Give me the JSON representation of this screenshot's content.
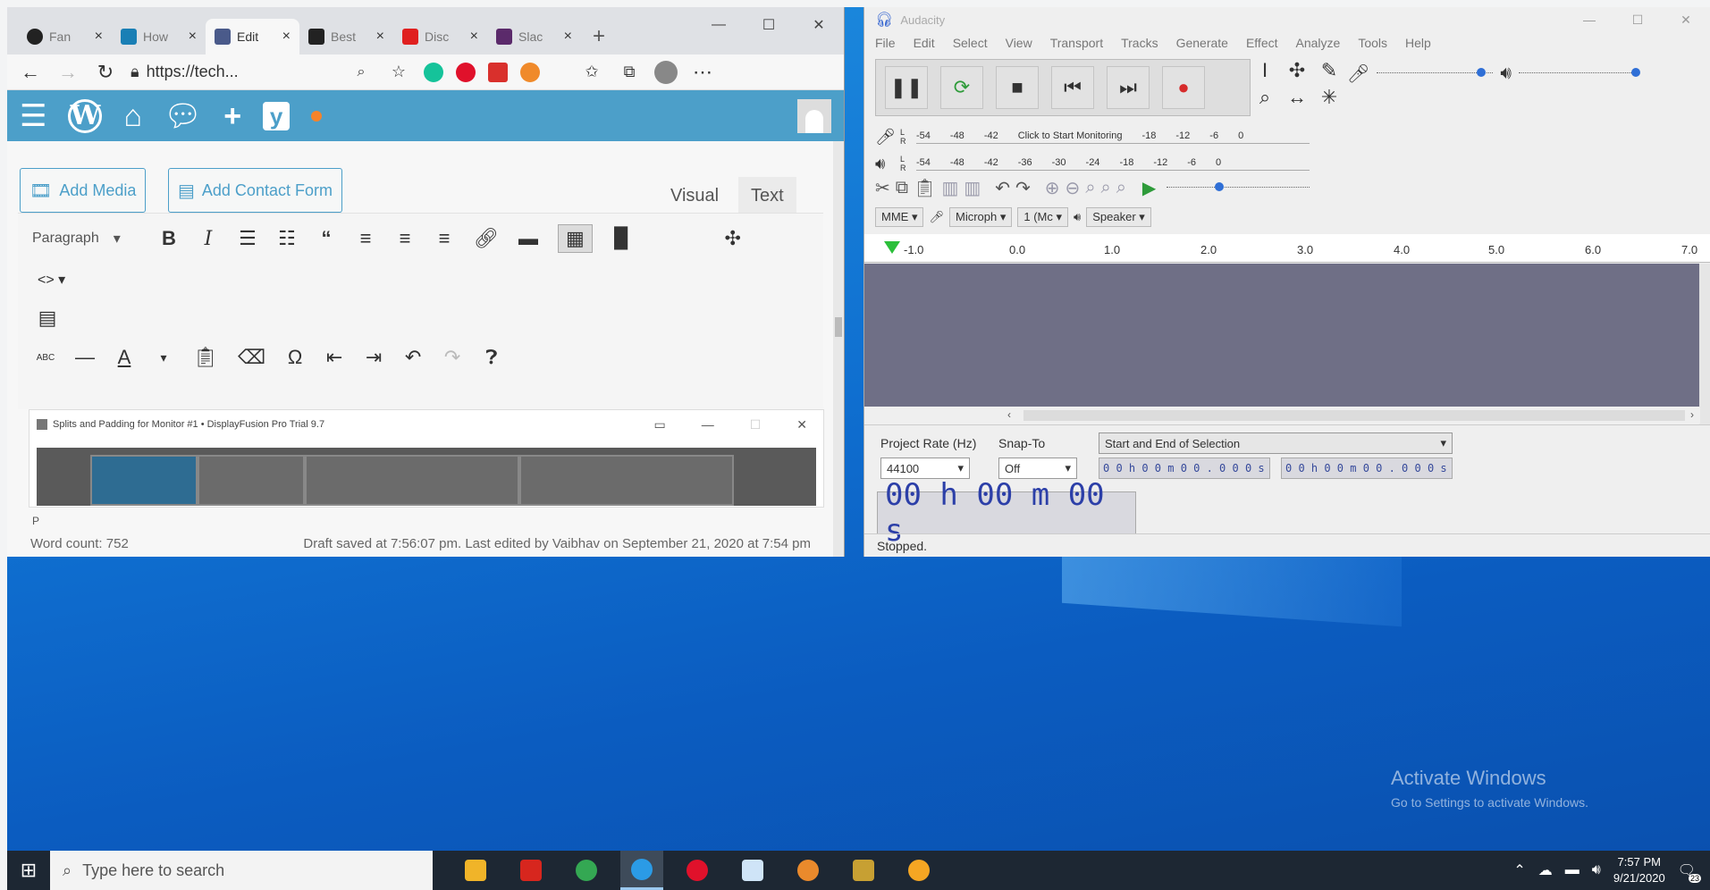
{
  "browser": {
    "tabs": [
      {
        "label": "Fan",
        "color": "#222222"
      },
      {
        "label": "How",
        "color": "#1a7fb5"
      },
      {
        "label": "Edit",
        "color": "#4a5a8a"
      },
      {
        "label": "Best",
        "color": "#222222"
      },
      {
        "label": "Disc",
        "color": "#e02020"
      },
      {
        "label": "Slac",
        "color": "#5b2a6b"
      }
    ],
    "new_tab": "+",
    "url": "https://tech...",
    "window_controls": {
      "minimize": "—",
      "maximize": "☐",
      "close": "✕"
    }
  },
  "wordpress": {
    "add_media": "Add Media",
    "add_contact_form": "Add Contact Form",
    "visual_tab": "Visual",
    "text_tab": "Text",
    "format_select": "Paragraph",
    "paragraph_marker": "P",
    "word_count": "Word count: 752",
    "draft_status": "Draft saved at 7:56:07 pm. Last edited by Vaibhav on September 21, 2020 at 7:54 pm"
  },
  "displayfusion": {
    "title": "Splits and Padding for Monitor #1 • DisplayFusion Pro Trial 9.7"
  },
  "audacity": {
    "title": "Audacity",
    "menu": [
      "File",
      "Edit",
      "Select",
      "View",
      "Transport",
      "Tracks",
      "Generate",
      "Effect",
      "Analyze",
      "Tools",
      "Help"
    ],
    "record_meter_ticks": [
      "-54",
      "-48",
      "-42",
      "Click to Start Monitoring",
      "-18",
      "-12",
      "-6",
      "0"
    ],
    "play_meter_ticks": [
      "-54",
      "-48",
      "-42",
      "-36",
      "-30",
      "-24",
      "-18",
      "-12",
      "-6",
      "0"
    ],
    "host": "MME",
    "input_device": "Microph",
    "channels": "1 (Mc",
    "output_device": "Speaker",
    "ruler_ticks": [
      "-1.0",
      "0.0",
      "1.0",
      "2.0",
      "3.0",
      "4.0",
      "5.0",
      "6.0",
      "7.0"
    ],
    "project_rate_label": "Project Rate (Hz)",
    "project_rate_value": "44100",
    "snap_to_label": "Snap-To",
    "snap_to_value": "Off",
    "selection_mode": "Start and End of Selection",
    "selection_start": "0 0 h 0 0 m 0 0 . 0 0 0 s",
    "selection_end": "0 0 h 0 0 m 0 0 . 0 0 0 s",
    "big_time": "00 h 00 m 00 s",
    "status": "Stopped."
  },
  "desktop": {
    "activate_title": "Activate Windows",
    "activate_sub": "Go to Settings to activate Windows."
  },
  "taskbar": {
    "search_placeholder": "Type here to search",
    "apps": [
      {
        "name": "file-explorer",
        "color": "#f0b429"
      },
      {
        "name": "acrobat",
        "color": "#d7261e"
      },
      {
        "name": "chrome",
        "color": "#34a853"
      },
      {
        "name": "edge",
        "color": "#2b9be6"
      },
      {
        "name": "opera",
        "color": "#e0112b"
      },
      {
        "name": "notepad",
        "color": "#cfe4f7"
      },
      {
        "name": "chrome-profile",
        "color": "#ea8a2c"
      },
      {
        "name": "photos",
        "color": "#c7a033"
      },
      {
        "name": "audacity",
        "color": "#f5a623"
      }
    ],
    "time": "7:57 PM",
    "date": "9/21/2020",
    "notifications": "23"
  }
}
